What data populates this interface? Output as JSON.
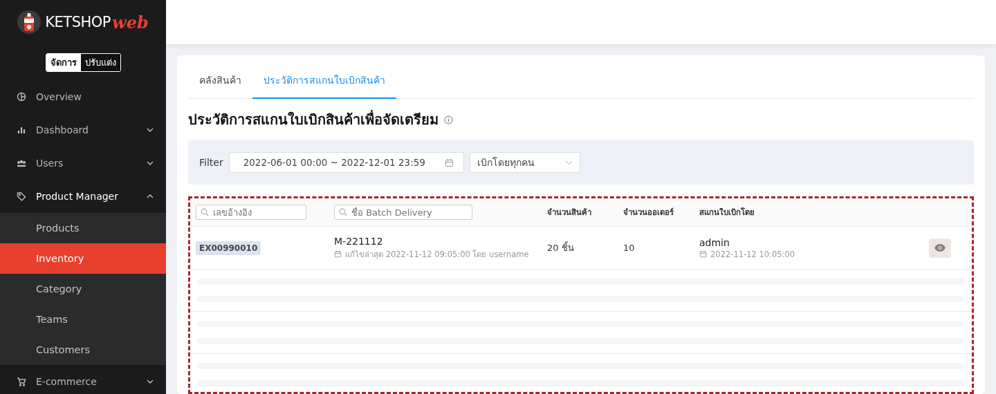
{
  "logo": {
    "name": "KETSHOP",
    "suffix": "web"
  },
  "mode_toggle": [
    {
      "label": "จัดการ",
      "selected": true
    },
    {
      "label": "ปรับแต่ง",
      "selected": false
    }
  ],
  "sidebar": {
    "items": [
      {
        "label": "Overview",
        "kind": "link"
      },
      {
        "label": "Dashboard",
        "kind": "group",
        "expanded": false
      },
      {
        "label": "Users",
        "kind": "group",
        "expanded": false
      },
      {
        "label": "Product Manager",
        "kind": "group",
        "expanded": true,
        "children": [
          {
            "label": "Products",
            "selected": false
          },
          {
            "label": "Inventory",
            "selected": true
          },
          {
            "label": "Category",
            "selected": false
          },
          {
            "label": "Teams",
            "selected": false
          },
          {
            "label": "Customers",
            "selected": false
          }
        ]
      },
      {
        "label": "E-commerce",
        "kind": "group",
        "expanded": false
      }
    ]
  },
  "tabs": [
    {
      "label": "คลังสินค้า",
      "selected": false
    },
    {
      "label": "ประวัติการสแกนใบเบิกสินค้า",
      "selected": true
    }
  ],
  "title": "ประวัติการสแกนใบเบิกสินค้าเพื่อจัดเตรียม",
  "filter": {
    "label": "Filter",
    "date_range": "2022-06-01 00:00 ~ 2022-12-01 23:59",
    "requester": "เบิกโดยทุกคน"
  },
  "table": {
    "search_ref": {
      "placeholder": "เลขอ้างอิง"
    },
    "search_batch": {
      "placeholder": "ชื่อ Batch Delivery"
    },
    "columns": [
      "จำนวนสินค้า",
      "จำนวนออเดอร์",
      "สแกนใบเบิกโดย"
    ],
    "rows": [
      {
        "ref": "EX00990010",
        "batch": "M-221112",
        "edited": "แก้ไขล่าสุด 2022-11-12 09:05:00 โดย username",
        "qty": "20 ชิ้น",
        "orders": "10",
        "scanned_by": "admin",
        "scanned_at": "2022-11-12 10:05:00"
      }
    ],
    "loading_rows": [
      {
        "kind": "skeleton"
      },
      {
        "kind": "skeleton"
      },
      {
        "kind": "skeleton"
      }
    ]
  }
}
